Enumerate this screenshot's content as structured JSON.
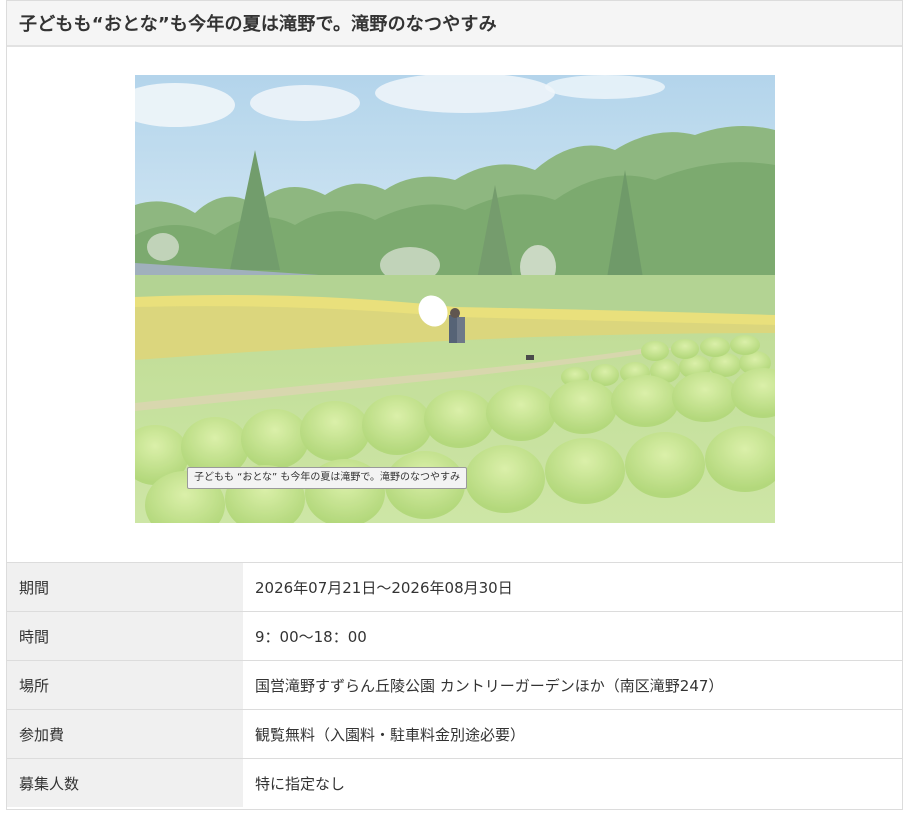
{
  "page": {
    "title": "子どもも“おとな”も今年の夏は滝野で。滝野のなつやすみ"
  },
  "photo": {
    "caption": "子どもも “おとな” も今年の夏は滝野で。滝野のなつやすみ"
  },
  "details": {
    "rows": [
      {
        "label": "期間",
        "value": "2026年07月21日～2026年08月30日"
      },
      {
        "label": "時間",
        "value": "9：00～18：00"
      },
      {
        "label": "場所",
        "value": "国営滝野すずらん丘陵公園 カントリーガーデンほか（南区滝野247）"
      },
      {
        "label": "参加費",
        "value": "観覧無料（入園料・駐車料金別途必要）"
      },
      {
        "label": "募集人数",
        "value": "特に指定なし"
      }
    ]
  }
}
